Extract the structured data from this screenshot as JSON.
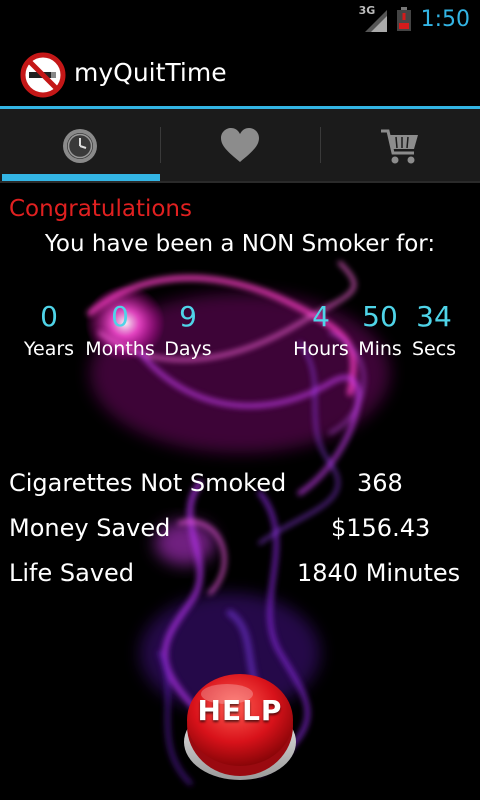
{
  "status_bar": {
    "network": "3G",
    "time": "1:50"
  },
  "action_bar": {
    "title": "myQuitTime",
    "icon": "no-smoking-icon"
  },
  "tabs": [
    {
      "icon": "clock-icon",
      "selected": true
    },
    {
      "icon": "heart-icon",
      "selected": false
    },
    {
      "icon": "cart-icon",
      "selected": false
    }
  ],
  "main": {
    "congrats": "Congratulations",
    "subtitle": "You have been a NON Smoker for:",
    "timer": [
      {
        "value": "0",
        "label": "Years"
      },
      {
        "value": "0",
        "label": "Months"
      },
      {
        "value": "9",
        "label": "Days"
      },
      {
        "value": "4",
        "label": "Hours"
      },
      {
        "value": "50",
        "label": "Mins"
      },
      {
        "value": "34",
        "label": "Secs"
      }
    ],
    "stats": [
      {
        "label": "Cigarettes Not Smoked",
        "value": "368"
      },
      {
        "label": "Money Saved",
        "value": "$156.43"
      },
      {
        "label": "Life Saved",
        "value": "1840 Minutes"
      }
    ],
    "help_label": "HELP"
  },
  "colors": {
    "accent": "#33b5e5",
    "congrats": "#e02020",
    "timer_number": "#4fd4e8",
    "help_button": "#d8121a"
  }
}
